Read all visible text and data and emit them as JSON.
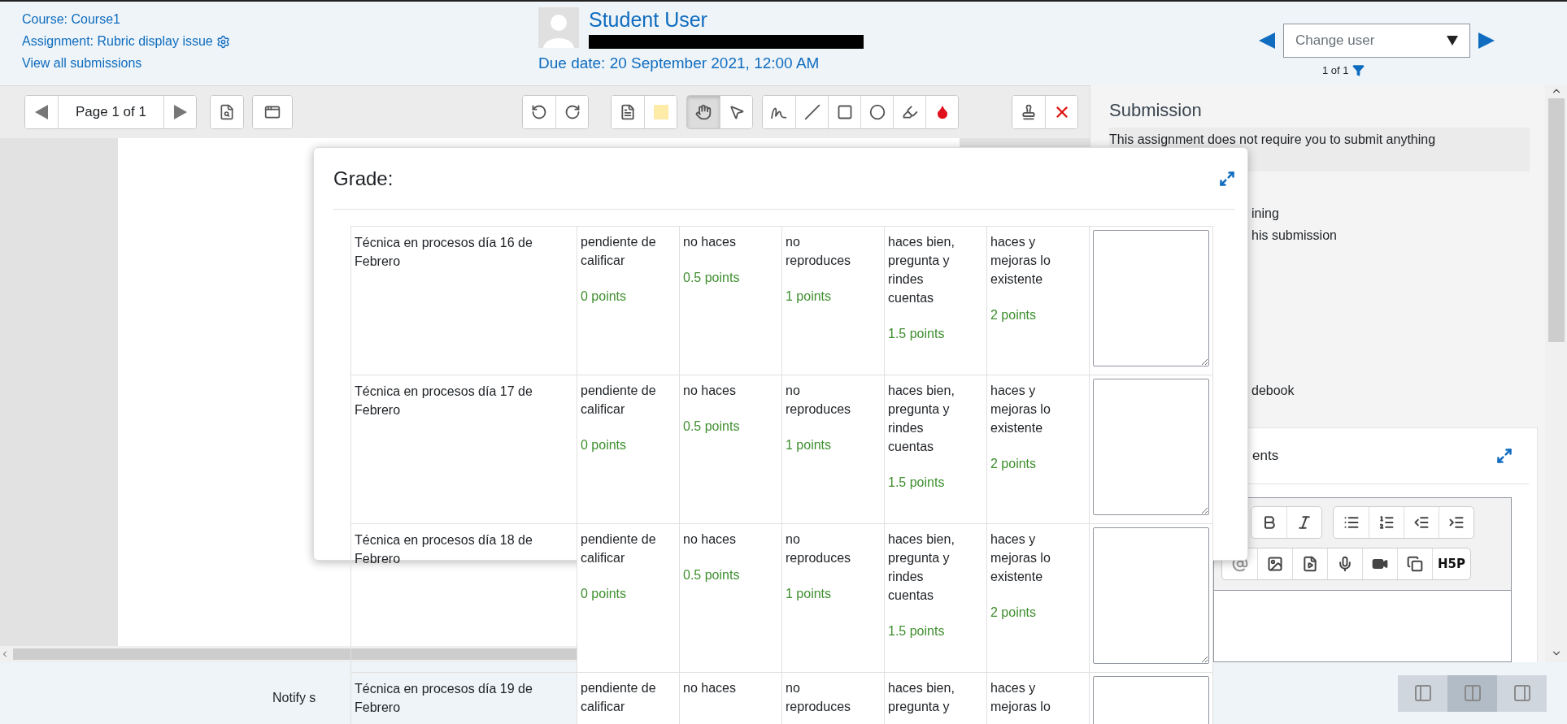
{
  "header": {
    "course_link": "Course: Course1",
    "assignment_link": "Assignment: Rubric display issue",
    "submissions_link": "View all submissions",
    "user_name": "Student User",
    "due_date": "Due date: 20 September 2021, 12:00 AM",
    "user_select": {
      "placeholder": "Change user"
    },
    "user_count": "1 of 1"
  },
  "toolbar": {
    "page_label": "Page 1 of 1",
    "tool_groups": [
      [
        {
          "kind": "rotate-left",
          "selected": false
        },
        {
          "kind": "rotate-right",
          "selected": false
        }
      ],
      [
        {
          "kind": "comment",
          "selected": false
        },
        {
          "kind": "comment-color",
          "selected": false
        }
      ],
      [
        {
          "kind": "pan",
          "selected": true
        },
        {
          "kind": "select",
          "selected": false
        }
      ],
      [
        {
          "kind": "pen",
          "selected": false
        },
        {
          "kind": "line",
          "selected": false
        },
        {
          "kind": "rectangle",
          "selected": false
        },
        {
          "kind": "oval",
          "selected": false
        },
        {
          "kind": "highlight",
          "selected": false
        },
        {
          "kind": "annotation-color",
          "selected": false
        }
      ],
      [
        {
          "kind": "stamp",
          "selected": false
        },
        {
          "kind": "delete",
          "selected": false
        }
      ]
    ]
  },
  "submission": {
    "title": "Submission",
    "notice": "This assignment does not require you to submit anything",
    "partial_lines": [
      "ining",
      "his submission"
    ],
    "partial_line_lower": "debook"
  },
  "feedback": {
    "title_fragment": "ents",
    "toolbar_rows": [
      [
        [
          {
            "kind": "bold"
          },
          {
            "kind": "italic"
          }
        ],
        [
          {
            "kind": "bullet-list"
          },
          {
            "kind": "numbered-list"
          },
          {
            "kind": "outdent"
          },
          {
            "kind": "indent"
          }
        ]
      ],
      [
        [
          {
            "kind": "at-sign"
          },
          {
            "kind": "image"
          },
          {
            "kind": "media-file"
          },
          {
            "kind": "microphone"
          },
          {
            "kind": "video"
          },
          {
            "kind": "manage-files"
          },
          {
            "kind": "h5p",
            "label": "H5P"
          }
        ]
      ]
    ]
  },
  "grade_modal": {
    "title": "Grade:",
    "rows": [
      {
        "criterion": "Técnica en procesos día 16 de Febrero",
        "levels": [
          {
            "description": "pendiente de calificar",
            "points": "0 points"
          },
          {
            "description": "no haces",
            "points": "0.5 points"
          },
          {
            "description": "no reproduces",
            "points": "1 points"
          },
          {
            "description": "haces bien, pregunta y rindes cuentas",
            "points": "1.5 points"
          },
          {
            "description": "haces y mejoras lo existente",
            "points": "2 points"
          }
        ]
      },
      {
        "criterion": "Técnica en procesos día 17 de Febrero",
        "levels": [
          {
            "description": "pendiente de calificar",
            "points": "0 points"
          },
          {
            "description": "no haces",
            "points": "0.5 points"
          },
          {
            "description": "no reproduces",
            "points": "1 points"
          },
          {
            "description": "haces bien, pregunta y rindes cuentas",
            "points": "1.5 points"
          },
          {
            "description": "haces y mejoras lo existente",
            "points": "2 points"
          }
        ]
      },
      {
        "criterion": "Técnica en procesos día 18 de Febrero",
        "levels": [
          {
            "description": "pendiente de calificar",
            "points": "0 points"
          },
          {
            "description": "no haces",
            "points": "0.5 points"
          },
          {
            "description": "no reproduces",
            "points": "1 points"
          },
          {
            "description": "haces bien, pregunta y rindes cuentas",
            "points": "1.5 points"
          },
          {
            "description": "haces y mejoras lo existente",
            "points": "2 points"
          }
        ]
      },
      {
        "criterion": "Técnica en procesos día 19 de Febrero",
        "levels": [
          {
            "description": "pendiente de calificar"
          },
          {
            "description": "no haces"
          },
          {
            "description": "no reproduces"
          },
          {
            "description": "haces bien, pregunta y"
          },
          {
            "description": "haces y mejoras lo"
          }
        ]
      }
    ]
  },
  "footer": {
    "notify_fragment": "Notify s",
    "layouts": [
      {
        "kind": "grader-only",
        "selected": false
      },
      {
        "kind": "split",
        "selected": true
      },
      {
        "kind": "document-only",
        "selected": false
      }
    ]
  }
}
